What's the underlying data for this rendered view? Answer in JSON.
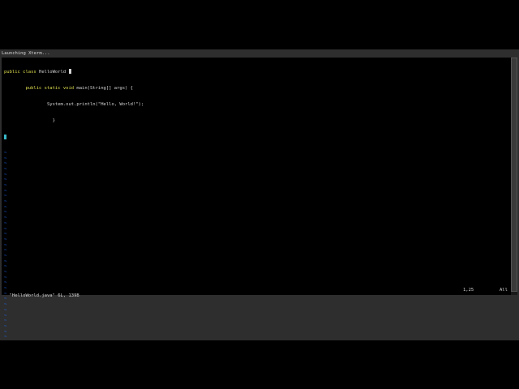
{
  "window": {
    "launch_text": "Launching Xterm..."
  },
  "editor": {
    "lines": [
      {
        "kw": "public class",
        "rest": " HelloWorld "
      },
      {
        "indent": "        ",
        "kw": "public static void",
        "rest": " main(String[] args) {"
      },
      {
        "indent": "                ",
        "rest": "System.out.println(\"Hello, World!\");"
      },
      {
        "indent": "                  ",
        "rest": "}"
      }
    ],
    "tilde": "~"
  },
  "statusline": {
    "file_info": "\"HelloWorld.java\" 6L, 139B",
    "position": "1,25",
    "percent": "All"
  },
  "colors": {
    "keyword": "#e0df4f",
    "tilde": "#1f6cff",
    "cursor": "#39b8c8",
    "text": "#d4d4d4"
  }
}
